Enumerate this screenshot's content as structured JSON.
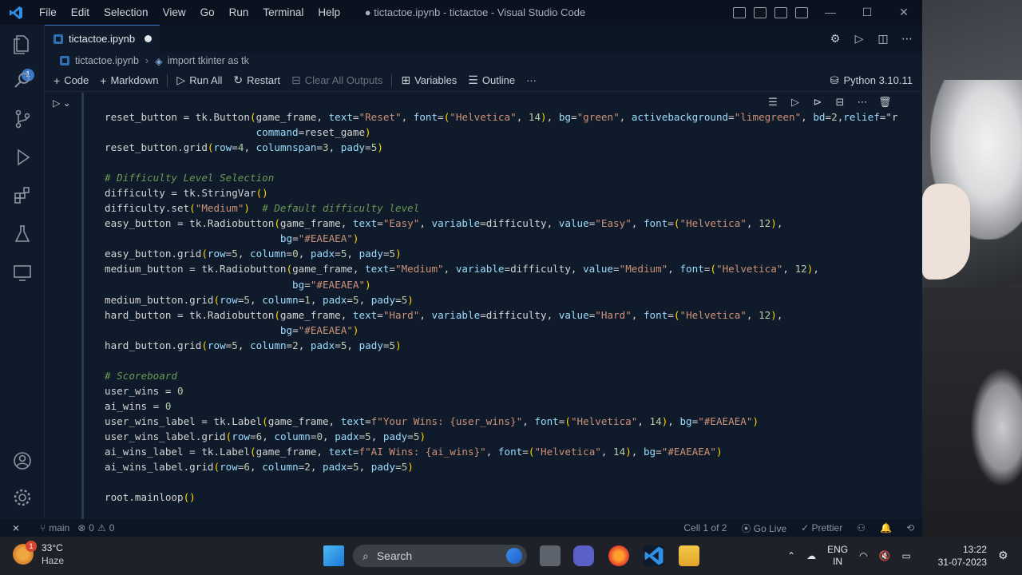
{
  "titlebar": {
    "menu": [
      "File",
      "Edit",
      "Selection",
      "View",
      "Go",
      "Run",
      "Terminal",
      "Help"
    ],
    "title": "● tictactoe.ipynb - tictactoe - Visual Studio Code",
    "controls": [
      "—",
      "☐",
      "✕"
    ]
  },
  "activity": {
    "badge": "1"
  },
  "tab": {
    "label": "tictactoe.ipynb"
  },
  "breadcrumb": {
    "file": "tictactoe.ipynb",
    "symbol": "import tkinter as tk"
  },
  "toolbar": {
    "code": "Code",
    "markdown": "Markdown",
    "run_all": "Run All",
    "restart": "Restart",
    "clear_outputs": "Clear All Outputs",
    "variables": "Variables",
    "outline": "Outline",
    "more": "···",
    "kernel": "Python 3.10.11"
  },
  "code_lines": [
    "reset_button = tk.Button(game_frame, text=\"Reset\", font=(\"Helvetica\", 14), bg=\"green\", activebackground=\"limegreen\", bd=2,relief=\"r",
    "                         command=reset_game)",
    "reset_button.grid(row=4, columnspan=3, pady=5)",
    "",
    "# Difficulty Level Selection",
    "difficulty = tk.StringVar()",
    "difficulty.set(\"Medium\")  # Default difficulty level",
    "easy_button = tk.Radiobutton(game_frame, text=\"Easy\", variable=difficulty, value=\"Easy\", font=(\"Helvetica\", 12),",
    "                             bg=\"#EAEAEA\")",
    "easy_button.grid(row=5, column=0, padx=5, pady=5)",
    "medium_button = tk.Radiobutton(game_frame, text=\"Medium\", variable=difficulty, value=\"Medium\", font=(\"Helvetica\", 12),",
    "                               bg=\"#EAEAEA\")",
    "medium_button.grid(row=5, column=1, padx=5, pady=5)",
    "hard_button = tk.Radiobutton(game_frame, text=\"Hard\", variable=difficulty, value=\"Hard\", font=(\"Helvetica\", 12),",
    "                             bg=\"#EAEAEA\")",
    "hard_button.grid(row=5, column=2, padx=5, pady=5)",
    "",
    "# Scoreboard",
    "user_wins = 0",
    "ai_wins = 0",
    "user_wins_label = tk.Label(game_frame, text=f\"Your Wins: {user_wins}\", font=(\"Helvetica\", 14), bg=\"#EAEAEA\")",
    "user_wins_label.grid(row=6, column=0, padx=5, pady=5)",
    "ai_wins_label = tk.Label(game_frame, text=f\"AI Wins: {ai_wins}\", font=(\"Helvetica\", 14), bg=\"#EAEAEA\")",
    "ai_wins_label.grid(row=6, column=2, padx=5, pady=5)",
    "",
    "root.mainloop()"
  ],
  "status": {
    "branch": "main",
    "errors": "0",
    "warnings": "0",
    "cell": "Cell 1 of 2",
    "golive": "Go Live",
    "prettier": "Prettier"
  },
  "taskbar": {
    "temp": "33°C",
    "weather": "Haze",
    "weather_badge": "1",
    "search": "Search",
    "lang1": "ENG",
    "lang2": "IN",
    "time": "13:22",
    "date": "31-07-2023"
  },
  "colors": {
    "accent": "#3b76c7",
    "editor_bg": "#0f1a2a",
    "comment": "#6a9955",
    "string": "#ce9178",
    "number": "#b5cea8"
  }
}
